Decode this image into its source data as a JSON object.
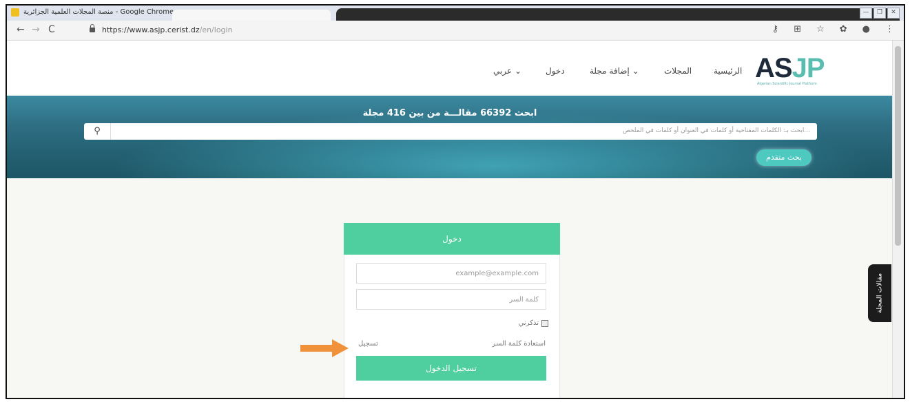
{
  "window": {
    "title": "منصة المجلات العلمية الجزائرية - Google Chrome",
    "controls": [
      "—",
      "❐",
      "✕"
    ]
  },
  "browser": {
    "url_host": "https://www.asjp.cerist.dz",
    "url_path": "/en/login",
    "back_label": "←",
    "forward_label": "→",
    "reload_label": "C"
  },
  "site": {
    "logo_as": "AS",
    "logo_jp": "JP",
    "logo_sub": "Algerian Scientific Journal Platform",
    "nav": {
      "home": "الرئيسية",
      "journals": "المجلات",
      "add_journal": "إضافة مجلة ⌄",
      "login": "دخول",
      "language": "عربي ⌄"
    }
  },
  "banner": {
    "title": "ابحث 66392 مقالـــة من بين 416 مجلة",
    "search_placeholder": "ابحث بـ: الكلمات المفتاحية أو كلمات في العنوان أو كلمات في الملخص...",
    "advanced_search": "بحث متقدم"
  },
  "login": {
    "header": "دخول",
    "email_placeholder": "example@example.com",
    "password_placeholder": "كلمة السر",
    "remember_me": "تذكرني",
    "forgot_password": "استعادة كلمة السر",
    "register": "تسجيل",
    "submit": "تسجيل الدخول"
  },
  "side_tab": {
    "label": "مقالات المجلة"
  },
  "colors": {
    "accent_green": "#4fcf9f",
    "banner_teal": "#2f6f84",
    "arrow_orange": "#f0923a"
  }
}
